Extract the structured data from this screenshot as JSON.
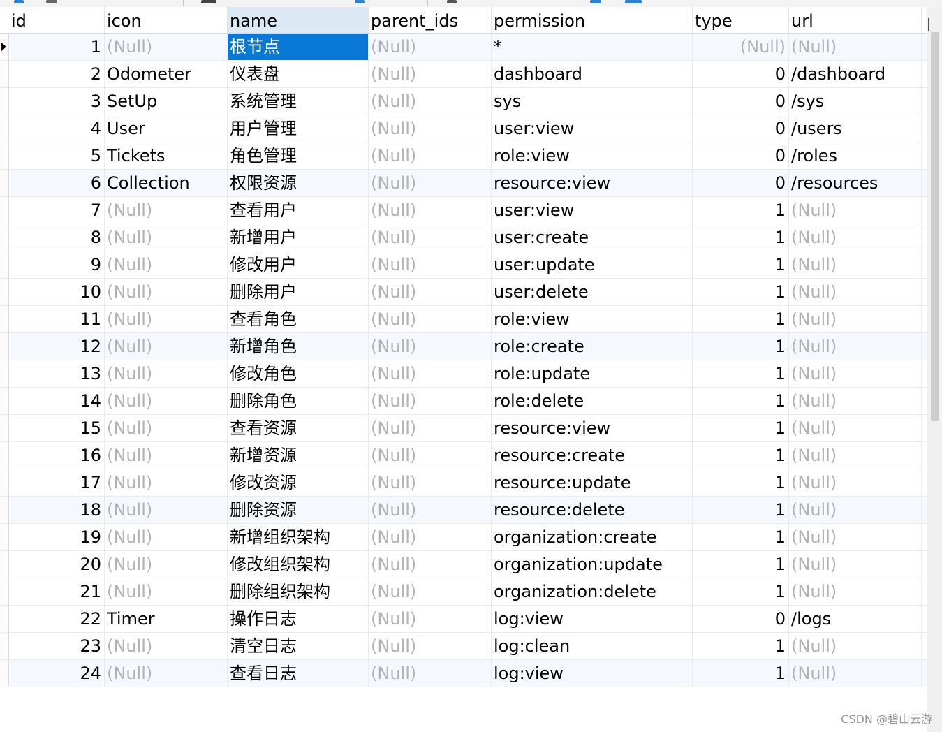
{
  "columns": [
    "id",
    "icon",
    "name",
    "parent_ids",
    "permission",
    "type",
    "url"
  ],
  "null_text": "(Null)",
  "rows": [
    {
      "id": "1",
      "icon": "(Null)",
      "name": "根节点",
      "parent_ids": "(Null)",
      "permission": "*",
      "type": "(Null)",
      "url": "(Null)"
    },
    {
      "id": "2",
      "icon": "Odometer",
      "name": "仪表盘",
      "parent_ids": "(Null)",
      "permission": "dashboard",
      "type": "0",
      "url": "/dashboard"
    },
    {
      "id": "3",
      "icon": "SetUp",
      "name": "系统管理",
      "parent_ids": "(Null)",
      "permission": "sys",
      "type": "0",
      "url": "/sys"
    },
    {
      "id": "4",
      "icon": "User",
      "name": "用户管理",
      "parent_ids": "(Null)",
      "permission": "user:view",
      "type": "0",
      "url": "/users"
    },
    {
      "id": "5",
      "icon": "Tickets",
      "name": "角色管理",
      "parent_ids": "(Null)",
      "permission": "role:view",
      "type": "0",
      "url": "/roles"
    },
    {
      "id": "6",
      "icon": "Collection",
      "name": "权限资源",
      "parent_ids": "(Null)",
      "permission": "resource:view",
      "type": "0",
      "url": "/resources"
    },
    {
      "id": "7",
      "icon": "(Null)",
      "name": "查看用户",
      "parent_ids": "(Null)",
      "permission": "user:view",
      "type": "1",
      "url": "(Null)"
    },
    {
      "id": "8",
      "icon": "(Null)",
      "name": "新增用户",
      "parent_ids": "(Null)",
      "permission": "user:create",
      "type": "1",
      "url": "(Null)"
    },
    {
      "id": "9",
      "icon": "(Null)",
      "name": "修改用户",
      "parent_ids": "(Null)",
      "permission": "user:update",
      "type": "1",
      "url": "(Null)"
    },
    {
      "id": "10",
      "icon": "(Null)",
      "name": "删除用户",
      "parent_ids": "(Null)",
      "permission": "user:delete",
      "type": "1",
      "url": "(Null)"
    },
    {
      "id": "11",
      "icon": "(Null)",
      "name": "查看角色",
      "parent_ids": "(Null)",
      "permission": "role:view",
      "type": "1",
      "url": "(Null)"
    },
    {
      "id": "12",
      "icon": "(Null)",
      "name": "新增角色",
      "parent_ids": "(Null)",
      "permission": "role:create",
      "type": "1",
      "url": "(Null)"
    },
    {
      "id": "13",
      "icon": "(Null)",
      "name": "修改角色",
      "parent_ids": "(Null)",
      "permission": "role:update",
      "type": "1",
      "url": "(Null)"
    },
    {
      "id": "14",
      "icon": "(Null)",
      "name": "删除角色",
      "parent_ids": "(Null)",
      "permission": "role:delete",
      "type": "1",
      "url": "(Null)"
    },
    {
      "id": "15",
      "icon": "(Null)",
      "name": "查看资源",
      "parent_ids": "(Null)",
      "permission": "resource:view",
      "type": "1",
      "url": "(Null)"
    },
    {
      "id": "16",
      "icon": "(Null)",
      "name": "新增资源",
      "parent_ids": "(Null)",
      "permission": "resource:create",
      "type": "1",
      "url": "(Null)"
    },
    {
      "id": "17",
      "icon": "(Null)",
      "name": "修改资源",
      "parent_ids": "(Null)",
      "permission": "resource:update",
      "type": "1",
      "url": "(Null)"
    },
    {
      "id": "18",
      "icon": "(Null)",
      "name": "删除资源",
      "parent_ids": "(Null)",
      "permission": "resource:delete",
      "type": "1",
      "url": "(Null)"
    },
    {
      "id": "19",
      "icon": "(Null)",
      "name": "新增组织架构",
      "parent_ids": "(Null)",
      "permission": "organization:create",
      "type": "1",
      "url": "(Null)"
    },
    {
      "id": "20",
      "icon": "(Null)",
      "name": "修改组织架构",
      "parent_ids": "(Null)",
      "permission": "organization:update",
      "type": "1",
      "url": "(Null)"
    },
    {
      "id": "21",
      "icon": "(Null)",
      "name": "删除组织架构",
      "parent_ids": "(Null)",
      "permission": "organization:delete",
      "type": "1",
      "url": "(Null)"
    },
    {
      "id": "22",
      "icon": "Timer",
      "name": "操作日志",
      "parent_ids": "(Null)",
      "permission": "log:view",
      "type": "0",
      "url": "/logs"
    },
    {
      "id": "23",
      "icon": "(Null)",
      "name": "清空日志",
      "parent_ids": "(Null)",
      "permission": "log:clean",
      "type": "1",
      "url": "(Null)"
    },
    {
      "id": "24",
      "icon": "(Null)",
      "name": "查看日志",
      "parent_ids": "(Null)",
      "permission": "log:view",
      "type": "1",
      "url": "(Null)"
    }
  ],
  "selection": {
    "row_index": 0,
    "column": "name"
  },
  "sorted_column": "name",
  "accent_color": "#0a78d7",
  "watermark": "CSDN @碧山云游"
}
